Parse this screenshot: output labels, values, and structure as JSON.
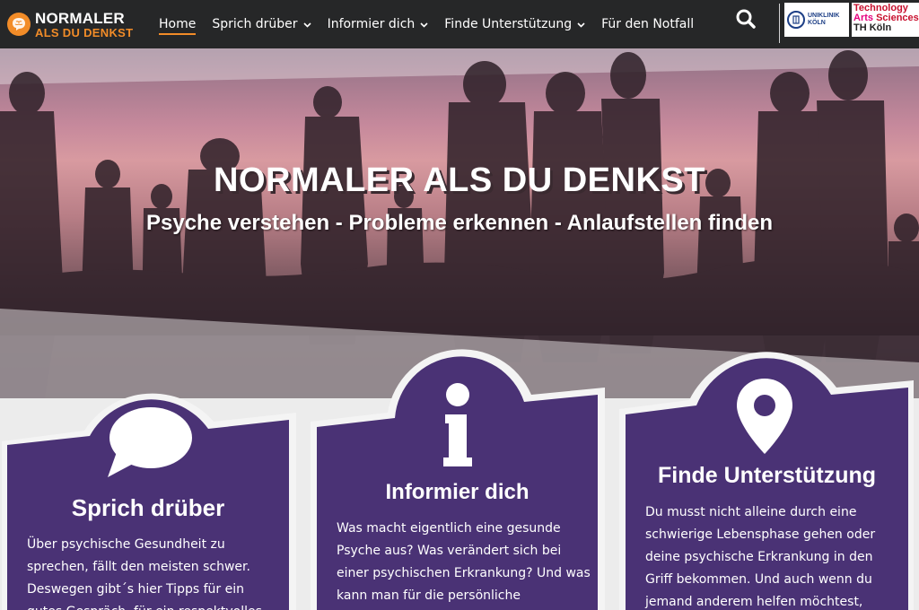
{
  "brand": {
    "line1": "NORMALER",
    "line2": "ALS DU DENKST"
  },
  "nav": [
    {
      "label": "Home",
      "active": true,
      "dropdown": false
    },
    {
      "label": "Sprich drüber",
      "active": false,
      "dropdown": true
    },
    {
      "label": "Informier dich",
      "active": false,
      "dropdown": true
    },
    {
      "label": "Finde Unterstützung",
      "active": false,
      "dropdown": true
    },
    {
      "label": "Für den Notfall",
      "active": false,
      "dropdown": false
    }
  ],
  "partners": {
    "uniklinik": {
      "line1": "UNIKLINIK",
      "line2": "KÖLN"
    },
    "th": {
      "line1": "Technology",
      "line2a": "Arts",
      "line2b": " Sciences",
      "line3": "TH Köln"
    }
  },
  "hero": {
    "title": "NORMALER ALS DU DENKST",
    "subtitle": "Psyche verstehen - Probleme erkennen - Anlaufstellen finden"
  },
  "cards": [
    {
      "icon": "speech-bubble-icon",
      "title": "Sprich drüber",
      "lines": [
        "Über psychische Gesundheit zu",
        "sprechen, fällt den meisten schwer.",
        "Deswegen gibt´s hier Tipps für ein",
        "gutes Gespräch, für ein respektvolles"
      ]
    },
    {
      "icon": "info-icon",
      "title": "Informier dich",
      "lines": [
        "Was macht eigentlich eine gesunde",
        "Psyche aus? Was verändert sich bei",
        "einer psychischen Erkrankung? Und was",
        "kann man für die persönliche"
      ]
    },
    {
      "icon": "location-pin-icon",
      "title": "Finde Unterstützung",
      "lines": [
        "Du musst nicht alleine durch eine",
        "schwierige Lebensphase gehen oder",
        "deine psychische Erkrankung in den",
        "Griff bekommen. Und auch wenn du",
        "jemand anderem helfen möchtest,"
      ]
    }
  ],
  "colors": {
    "header": "#262728",
    "accent": "#f28c28",
    "card": "#4a3275",
    "page": "#ececec"
  }
}
